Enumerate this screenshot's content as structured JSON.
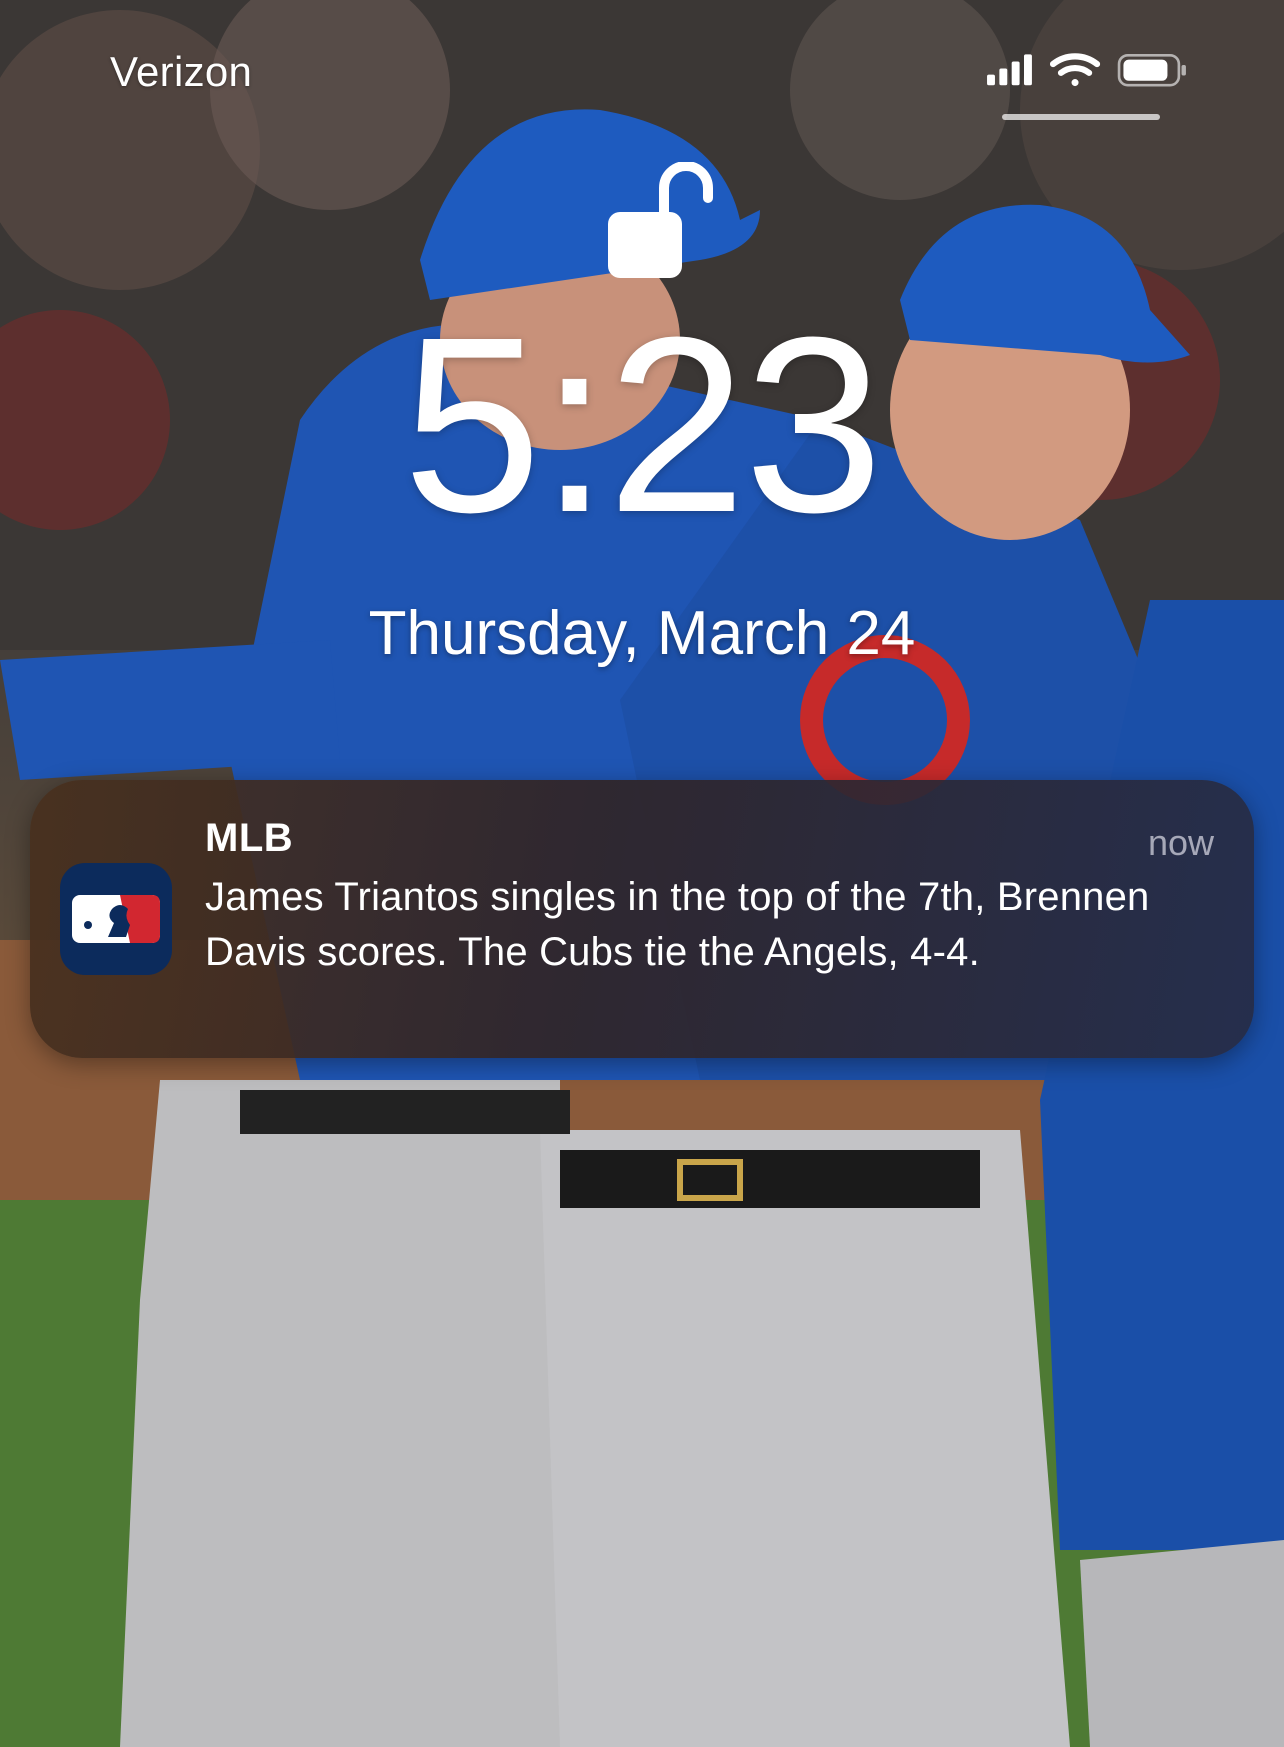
{
  "status_bar": {
    "carrier": "Verizon",
    "signal_icon": "cellular-signal-icon",
    "wifi_icon": "wifi-icon",
    "battery_icon": "battery-icon"
  },
  "lock_screen": {
    "lock_icon": "unlocked-padlock-icon",
    "time": "5:23",
    "date": "Thursday, March 24"
  },
  "notification": {
    "app_name": "MLB",
    "app_icon": "mlb-logo-icon",
    "timestamp": "now",
    "message": "James Triantos singles in the top of the 7th, Brennen Davis scores. The Cubs tie the Angels, 4-4."
  },
  "wallpaper": {
    "description_icon": "wallpaper-photo"
  },
  "colors": {
    "cubs_blue": "#1f55b3",
    "mlb_navy": "#0c2b5c",
    "mlb_red": "#d22730"
  }
}
